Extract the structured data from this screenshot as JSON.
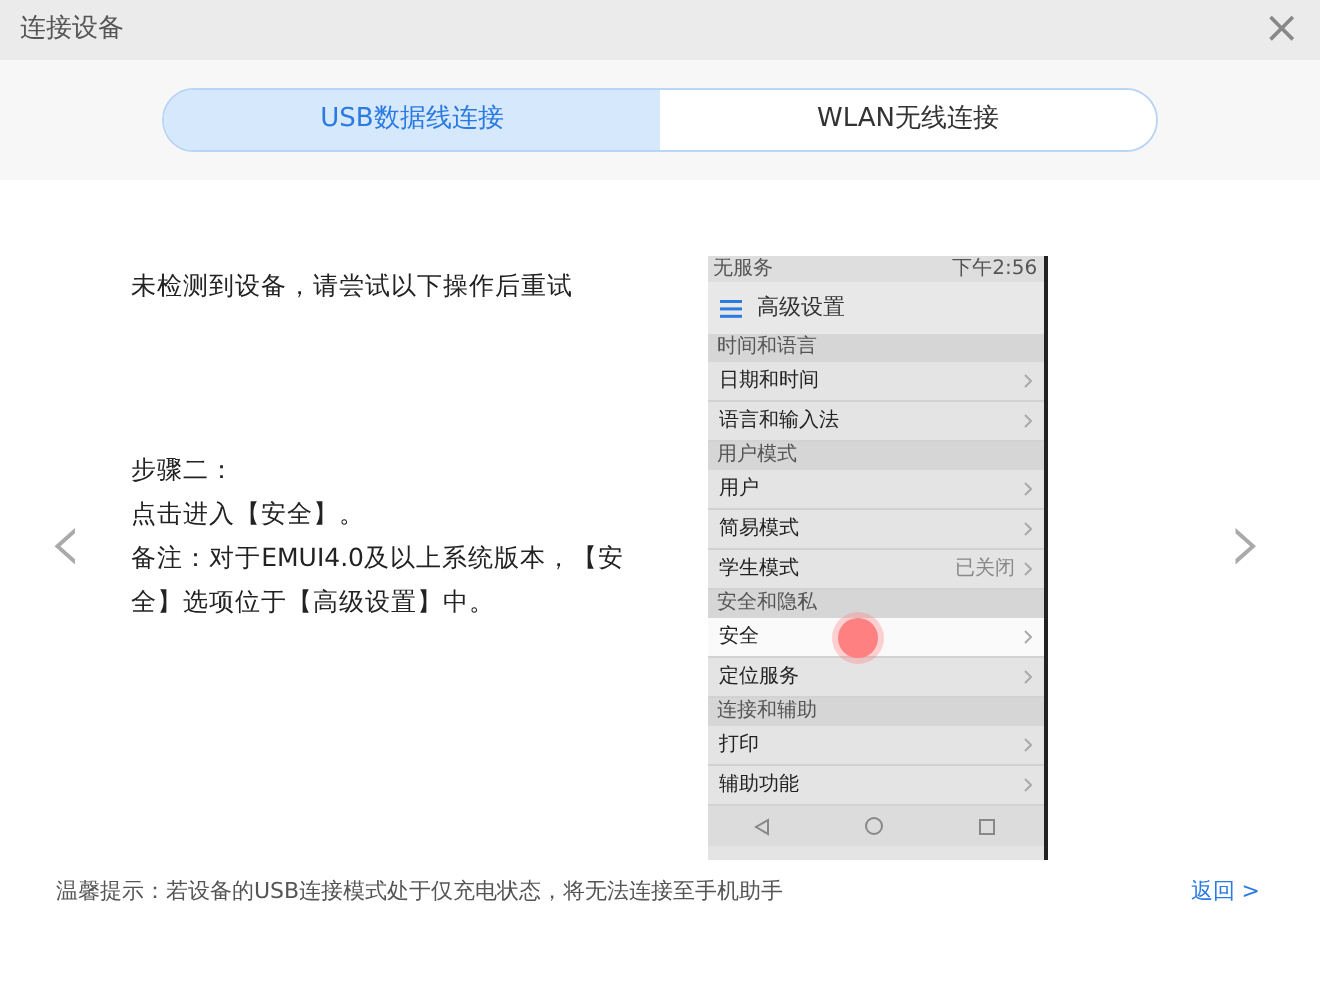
{
  "window": {
    "title": "连接设备",
    "close": "×"
  },
  "tabs": [
    {
      "label": "USB数据线连接",
      "selected": true
    },
    {
      "label": "WLAN无线连接",
      "selected": false
    }
  ],
  "message": "未检测到设备，请尝试以下操作后重试",
  "step": {
    "heading": "步骤二：",
    "lines": [
      "点击进入【安全】。",
      "备注：对于EMUI4.0及以上系统版本，【安全】选项位于【高级设置】中。"
    ]
  },
  "nav": {
    "prev": "‹",
    "next": "›"
  },
  "phone": {
    "status_left": "无服务",
    "status_right": "下午2:56",
    "title": "高级设置",
    "rows": [
      {
        "kind": "header",
        "label": "时间和语言"
      },
      {
        "kind": "item",
        "label": "日期和时间",
        "highlighted": false
      },
      {
        "kind": "item",
        "label": "语言和输入法",
        "highlighted": false
      },
      {
        "kind": "header",
        "label": "用户模式"
      },
      {
        "kind": "item",
        "label": "用户",
        "highlighted": false
      },
      {
        "kind": "item",
        "label": "简易模式",
        "highlighted": false
      },
      {
        "kind": "item",
        "label": "学生模式",
        "value": "已关闭",
        "highlighted": false
      },
      {
        "kind": "header",
        "label": "安全和隐私"
      },
      {
        "kind": "item",
        "label": "安全",
        "highlighted": true
      },
      {
        "kind": "item",
        "label": "定位服务",
        "highlighted": false
      },
      {
        "kind": "header",
        "label": "连接和辅助"
      },
      {
        "kind": "item",
        "label": "打印",
        "highlighted": false
      },
      {
        "kind": "item",
        "label": "辅助功能",
        "highlighted": false
      }
    ]
  },
  "footer": {
    "tip": "温馨提示：若设备的USB连接模式处于仅充电状态，将无法连接至手机助手",
    "back": "返回 >"
  }
}
